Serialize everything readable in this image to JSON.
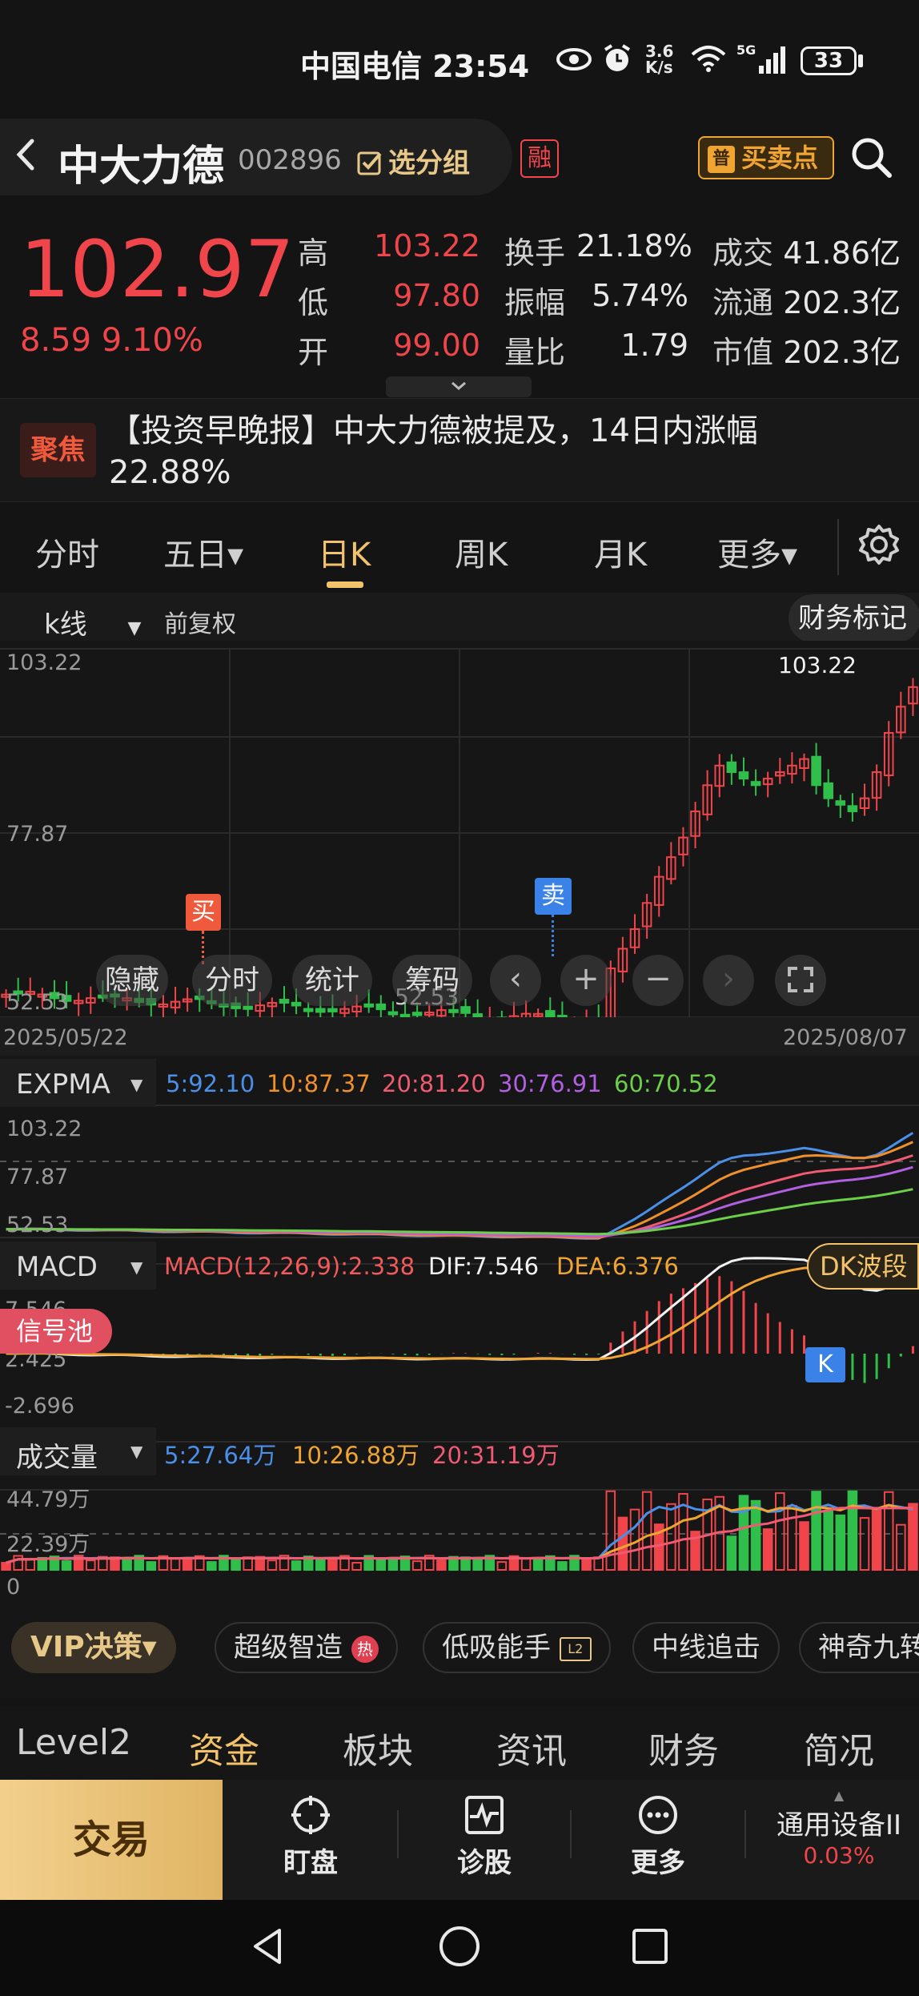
{
  "status_bar": {
    "carrier_time": "中国电信 23:54",
    "icons": [
      "eye-icon",
      "alarm-icon",
      "speed-icon",
      "wifi-icon",
      "5g-signal-icon"
    ],
    "net_speed": "3.6 K/s",
    "network": "5G",
    "battery": "33"
  },
  "header": {
    "back_icon": "chevron-left-icon",
    "stock_name": "中大力德",
    "stock_code": "002896",
    "group_button": "选分组",
    "margin_badge": "融",
    "buy_sell_badge_icon": "普",
    "buy_sell_points": "买卖点",
    "search_icon": "search-icon"
  },
  "quote": {
    "price": "102.97",
    "change": "8.59",
    "change_pct": "9.10%",
    "rows": [
      {
        "l1": "高",
        "v1": "103.22",
        "l2": "换手",
        "v2": "21.18%",
        "l3": "成交",
        "v3": "41.86亿"
      },
      {
        "l1": "低",
        "v1": "97.80",
        "l2": "振幅",
        "v2": "5.74%",
        "l3": "流通",
        "v3": "202.3亿"
      },
      {
        "l1": "开",
        "v1": "99.00",
        "l2": "量比",
        "v2": "1.79",
        "l3": "市值",
        "v3": "202.3亿"
      }
    ],
    "expand_icon": "chevron-down-icon"
  },
  "news": {
    "tag": "聚焦",
    "text": "【投资早晚报】中大力德被提及，14日内涨幅22.88%"
  },
  "period_tabs": [
    {
      "label": "分时"
    },
    {
      "label": "五日▾"
    },
    {
      "label": "日K",
      "active": true
    },
    {
      "label": "周K"
    },
    {
      "label": "月K"
    },
    {
      "label": "更多▾"
    }
  ],
  "settings_icon": "gear-icon",
  "kline": {
    "selector": "k线",
    "adjust": "前复权",
    "finance_mark": "财务标记",
    "y_top": "103.22",
    "y_mid": "77.87",
    "y_bottom": "52.53",
    "high_label": "103.22",
    "low_label": "52.53",
    "date_start": "2025/05/22",
    "date_end": "2025/08/07",
    "buy_marker": "买",
    "sell_marker": "卖",
    "controls": [
      "隐藏",
      "分时",
      "统计",
      "筹码"
    ]
  },
  "expma": {
    "name": "EXPMA",
    "legend": [
      {
        "text": "5:92.10",
        "color": "#4a8fe8"
      },
      {
        "text": "10:87.37",
        "color": "#f0902a"
      },
      {
        "text": "20:81.20",
        "color": "#f05a72"
      },
      {
        "text": "30:76.91",
        "color": "#b060e0"
      },
      {
        "text": "60:70.52",
        "color": "#6ccf4a"
      }
    ],
    "y_top": "103.22",
    "y_mid": "77.87",
    "y_bottom": "52.53"
  },
  "macd": {
    "name": "MACD",
    "legend": [
      {
        "text": "MACD(12,26,9):2.338",
        "color": "#f05a5a"
      },
      {
        "text": "DIF:7.546",
        "color": "#f2f2f2"
      },
      {
        "text": "DEA:6.376",
        "color": "#f0a432"
      }
    ],
    "signal_pool": "信号池",
    "dk_band": "DK波段",
    "k_marker": "K",
    "y_top": "7.546",
    "y_mid": "2.425",
    "y_bottom": "-2.696"
  },
  "volume": {
    "name": "成交量",
    "legend": [
      {
        "text": "5:27.64万",
        "color": "#4a8fe8"
      },
      {
        "text": "10:26.88万",
        "color": "#f0a432"
      },
      {
        "text": "20:31.19万",
        "color": "#f05a72"
      }
    ],
    "y_top": "44.79万",
    "y_mid": "22.39万",
    "y_bottom": "0"
  },
  "features": {
    "vip": "VIP决策▾",
    "items": [
      "超级智造",
      "低吸能手",
      "中线追击",
      "神奇九转"
    ],
    "hot_badge": "热"
  },
  "bottom_tabs": [
    {
      "label": "Level2"
    },
    {
      "label": "资金",
      "active": true
    },
    {
      "label": "板块"
    },
    {
      "label": "资讯"
    },
    {
      "label": "财务"
    },
    {
      "label": "简况"
    }
  ],
  "action_bar": {
    "trade": "交易",
    "items": [
      {
        "label": "盯盘",
        "icon": "crosshair-icon"
      },
      {
        "label": "诊股",
        "icon": "pulse-chart-icon"
      },
      {
        "label": "更多",
        "icon": "more-dots-icon"
      }
    ],
    "sector_name": "通用设备II",
    "sector_change": "0.03%"
  },
  "nav_bar": {
    "icons": [
      "back-triangle-icon",
      "home-circle-icon",
      "recent-square-icon"
    ]
  },
  "colors": {
    "up": "#f0454a",
    "down": "#2fbf4a",
    "accent": "#f2c36b",
    "background": "#141414"
  }
}
